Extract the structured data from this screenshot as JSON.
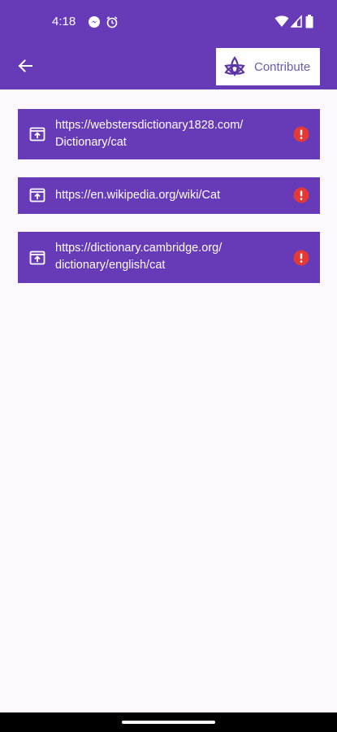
{
  "status_bar": {
    "time": "4:18",
    "icons": [
      "messenger-icon",
      "alarm-icon",
      "wifi-icon",
      "signal-icon",
      "battery-icon"
    ]
  },
  "app_bar": {
    "back_icon": "arrow-left-icon",
    "contribute_label": "Contribute",
    "contribute_icon": "triquetra-logo-icon"
  },
  "links": [
    {
      "url": "https://webstersdictionary1828.com/\nDictionary/cat",
      "open_icon": "open-in-browser-icon",
      "status_icon": "error-icon"
    },
    {
      "url": "https://en.wikipedia.org/wiki/Cat",
      "open_icon": "open-in-browser-icon",
      "status_icon": "error-icon"
    },
    {
      "url": "https://dictionary.cambridge.org/\ndictionary/english/cat",
      "open_icon": "open-in-browser-icon",
      "status_icon": "error-icon"
    }
  ],
  "colors": {
    "primary": "#673ab7",
    "background": "#fdf7fe",
    "error": "#e53935",
    "contribute_text": "#6b5bb0"
  }
}
